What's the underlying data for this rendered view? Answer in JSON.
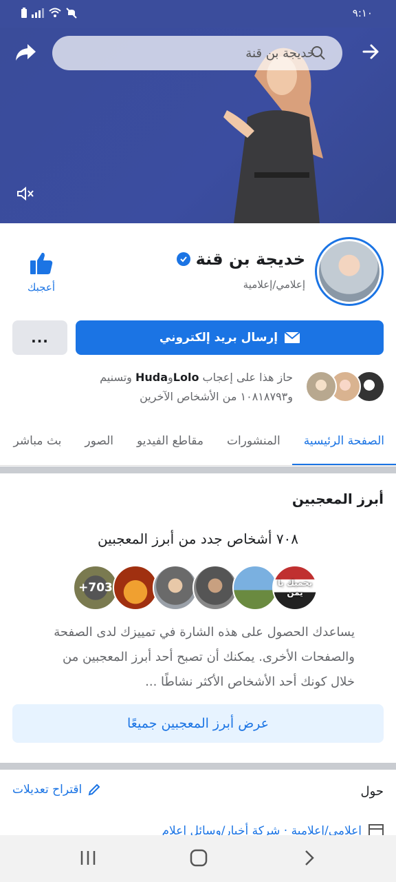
{
  "status_bar": {
    "time": "٩:١٠"
  },
  "header": {
    "search_value": "خديجة بن قنة"
  },
  "profile": {
    "name": "خديجة بن قنة",
    "category": "إعلامي/إعلامية",
    "like_label": "أعجبك",
    "email_button": "إرسال بريد إلكتروني",
    "more_button": "..."
  },
  "likes_info": {
    "prefix": "حاز هذا على إعجاب",
    "friend1": "Lolo",
    "connector": "و",
    "friend2": "Huda",
    "middle": "وتسنيم",
    "suffix": "و١٠٨١٨٧٩٣ من الأشخاص الآخرين"
  },
  "tabs": [
    {
      "label": "الصفحة الرئيسية",
      "active": true
    },
    {
      "label": "المنشورات",
      "active": false
    },
    {
      "label": "مقاطع الفيديو",
      "active": false
    },
    {
      "label": "الصور",
      "active": false
    },
    {
      "label": "بث مباشر",
      "active": false
    }
  ],
  "top_fans": {
    "title": "أبرز المعجبين",
    "count_text": "٧٠٨ أشخاص جدد من أبرز المعجبين",
    "more_count": "+703",
    "fan_badge_text": "يحميك يا يمن",
    "description": "يساعدك الحصول على هذه الشارة في تمييزك لدى الصفحة والصفحات الأخرى. يمكنك أن تصبح أحد أبرز المعجبين من خلال كونك أحد الأشخاص الأكثر نشاطًا ...",
    "see_all": "عرض أبرز المعجبين جميعًا"
  },
  "about": {
    "label": "حول",
    "suggest_edits": "اقتراح تعديلات",
    "category_line": "إعلامي/إعلامية · شركة أخبار/وسائل إعلام"
  },
  "colors": {
    "accent": "#1b74e4",
    "cover": "#3b4d9c"
  }
}
